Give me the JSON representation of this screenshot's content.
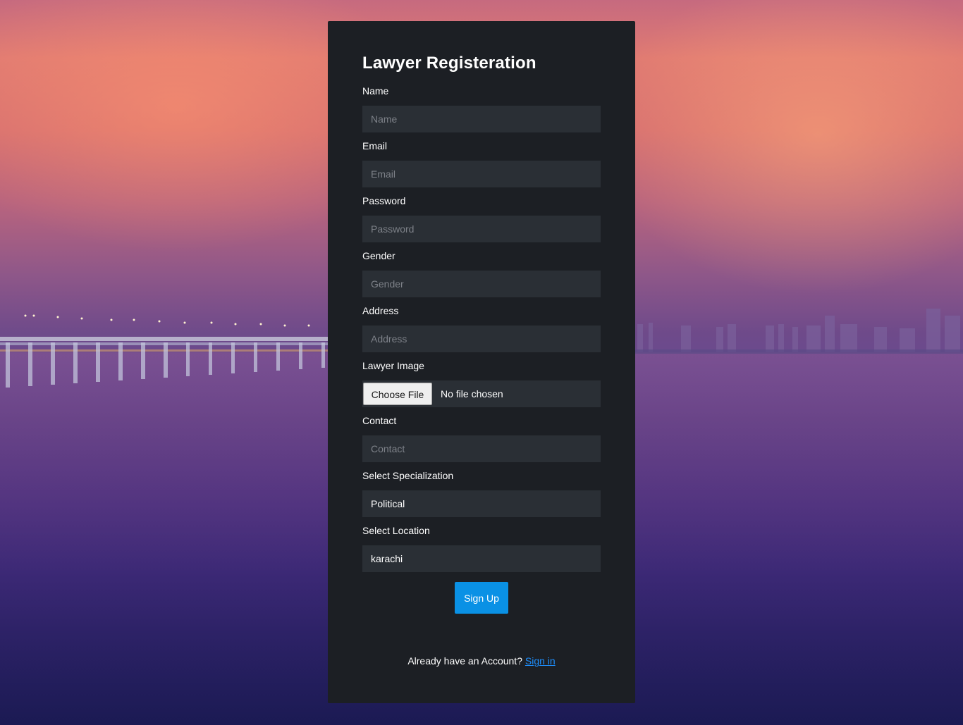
{
  "form": {
    "title": "Lawyer Registeration",
    "fields": {
      "name": {
        "label": "Name",
        "placeholder": "Name"
      },
      "email": {
        "label": "Email",
        "placeholder": "Email"
      },
      "password": {
        "label": "Password",
        "placeholder": "Password"
      },
      "gender": {
        "label": "Gender",
        "placeholder": "Gender"
      },
      "address": {
        "label": "Address",
        "placeholder": "Address"
      },
      "image": {
        "label": "Lawyer Image",
        "button": "Choose File",
        "status": "No file chosen"
      },
      "contact": {
        "label": "Contact",
        "placeholder": "Contact"
      },
      "specialization": {
        "label": "Select Specialization",
        "value": "Political"
      },
      "location": {
        "label": "Select Location",
        "value": "karachi"
      }
    },
    "submit_label": "Sign Up",
    "footer": {
      "text": "Already have an Account?",
      "link": "Sign in"
    }
  },
  "colors": {
    "card": "#1c1f24",
    "input": "#2a2f35",
    "accent": "#0a91e5",
    "link": "#1e90ff"
  }
}
